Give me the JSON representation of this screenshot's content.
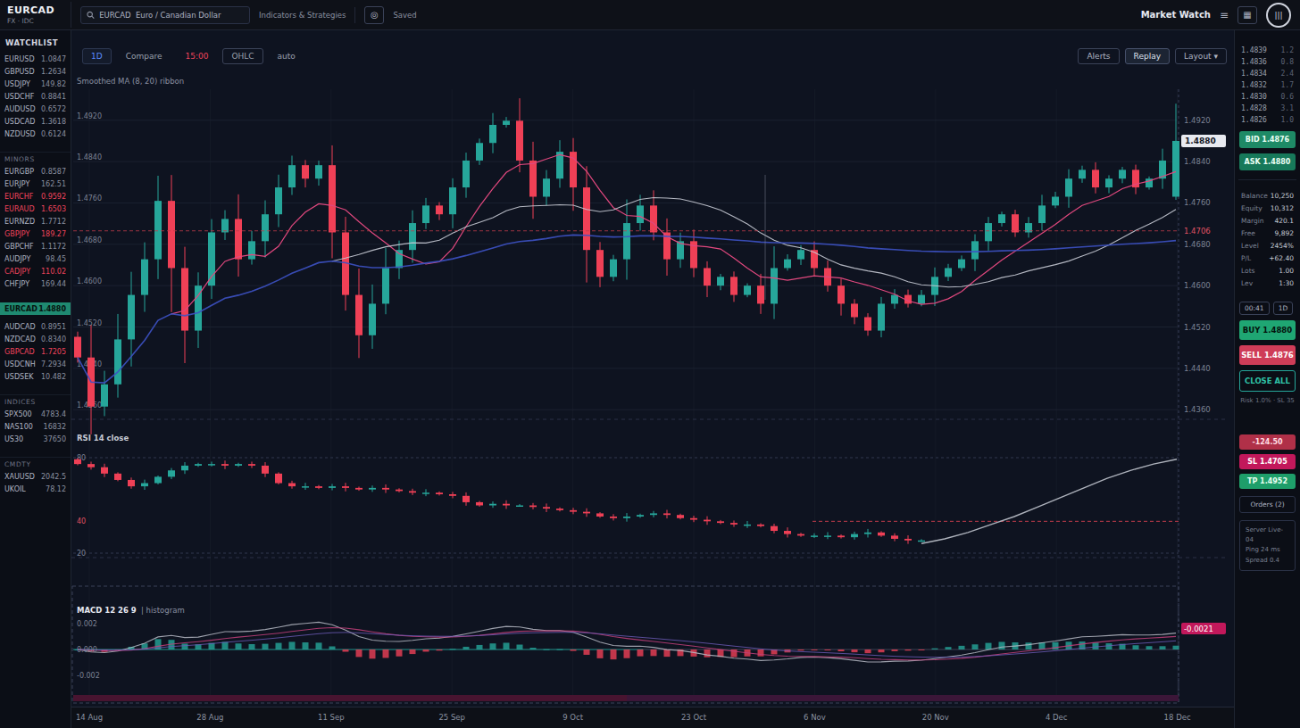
{
  "header": {
    "symbol": "EURCAD",
    "symbol_sub": "FX · IDC",
    "search_value": "EURCAD  Euro / Canadian Dollar",
    "indicators_label": "Indicators & Strategies",
    "saved_label": "Saved",
    "watch_title": "Market Watch"
  },
  "tabs": {
    "left": [
      {
        "label": "1D",
        "style": "active"
      },
      {
        "label": "Compare",
        "style": ""
      },
      {
        "label": "15:00",
        "style": "alert"
      },
      {
        "label": "OHLC",
        "style": "boxed"
      },
      {
        "label": "auto",
        "style": ""
      }
    ],
    "right": [
      {
        "label": "Alerts",
        "style": ""
      },
      {
        "label": "Replay",
        "style": "filled"
      },
      {
        "label": "Layout ▾",
        "style": ""
      }
    ]
  },
  "titles": {
    "main": "Smoothed MA (8, 20) ribbon",
    "panel2": "RSI 14 close",
    "panel3_bold": "MACD 12 26 9",
    "panel3_light": "| histogram"
  },
  "watchlist": {
    "title": "WATCHLIST",
    "rows": [
      {
        "sym": "EURUSD",
        "price": "1.0847"
      },
      {
        "sym": "GBPUSD",
        "price": "1.2634"
      },
      {
        "sym": "USDJPY",
        "price": "149.82"
      },
      {
        "sym": "USDCHF",
        "price": "0.8841"
      },
      {
        "sym": "AUDUSD",
        "price": "0.6572"
      },
      {
        "sym": "USDCAD",
        "price": "1.3618"
      },
      {
        "sym": "NZDUSD",
        "price": "0.6124"
      },
      {
        "sec": "MINORS"
      },
      {
        "sym": "EURGBP",
        "price": "0.8587"
      },
      {
        "sym": "EURJPY",
        "price": "162.51"
      },
      {
        "sym": "EURCHF",
        "price": "0.9592",
        "dir": "down"
      },
      {
        "sym": "EURAUD",
        "price": "1.6503",
        "dir": "down"
      },
      {
        "sym": "EURNZD",
        "price": "1.7712"
      },
      {
        "sym": "GBPJPY",
        "price": "189.27",
        "dir": "down"
      },
      {
        "sym": "GBPCHF",
        "price": "1.1172"
      },
      {
        "sym": "AUDJPY",
        "price": "98.45"
      },
      {
        "sym": "CADJPY",
        "price": "110.02",
        "dir": "down"
      },
      {
        "sym": "CHFJPY",
        "price": "169.44"
      },
      {
        "sym": "EURCAD",
        "price": "1.4880",
        "active": true
      },
      {
        "sym": "AUDCAD",
        "price": "0.8951"
      },
      {
        "sym": "NZDCAD",
        "price": "0.8340"
      },
      {
        "sym": "GBPCAD",
        "price": "1.7205",
        "dir": "down"
      },
      {
        "sym": "USDCNH",
        "price": "7.2934"
      },
      {
        "sym": "USDSEK",
        "price": "10.482"
      },
      {
        "sec": "INDICES"
      },
      {
        "sym": "SPX500",
        "price": "4783.4"
      },
      {
        "sym": "NAS100",
        "price": "16832"
      },
      {
        "sym": "US30",
        "price": "37650"
      },
      {
        "sec": "CMDTY"
      },
      {
        "sym": "XAUUSD",
        "price": "2042.5"
      },
      {
        "sym": "UKOIL",
        "price": "78.12"
      }
    ]
  },
  "right_panel": {
    "ladder": [
      [
        "1.4839",
        "1.2"
      ],
      [
        "1.4836",
        "0.8"
      ],
      [
        "1.4834",
        "2.4"
      ],
      [
        "1.4832",
        "1.7"
      ],
      [
        "1.4830",
        "0.6"
      ],
      [
        "1.4828",
        "3.1"
      ],
      [
        "1.4826",
        "1.0"
      ]
    ],
    "bid_label": "BID 1.4876",
    "ask_label": "ASK 1.4880",
    "account": [
      [
        "Balance",
        "10,250"
      ],
      [
        "Equity",
        "10,312"
      ],
      [
        "Margin",
        "420.1"
      ],
      [
        "Free",
        "9,892"
      ],
      [
        "Level",
        "2454%"
      ],
      [
        "P/L",
        "+62.40"
      ],
      [
        "Lots",
        "1.00"
      ],
      [
        "Lev",
        "1:30"
      ]
    ],
    "time_chip": "00:41",
    "tf_chip": "1D",
    "buy_button": "BUY 1.4880",
    "sell_button": "SELL 1.4876",
    "close_button": "CLOSE ALL",
    "risk_note": "Risk 1.0% · SL 35",
    "pl_badge": "-124.50",
    "sl_badge": "SL 1.4705",
    "tp_badge": "TP 1.4952",
    "orders_label": "Orders (2)",
    "status_lines": [
      "Server Live-04",
      "Ping 24 ms",
      "Spread 0.4"
    ]
  },
  "scale": {
    "last_tag": "1.4880",
    "dashed_tag": "1.4706",
    "macd_tag": "-0.0021"
  },
  "colors": {
    "up": "#26a69a",
    "down": "#ef4056",
    "ma_fast": "#e0487e",
    "ma_mid": "#c6cad4",
    "ma_slow": "#3d52c4",
    "dashed_level": "#c23b4b",
    "accent": "#2962ff"
  },
  "chart_data": [
    {
      "type": "candlestick",
      "panel": "price",
      "symbol": "EURCAD",
      "timeframe": "1D",
      "ylim": [
        1.435,
        1.498
      ],
      "y_ticks": [
        1.492,
        1.484,
        1.476,
        1.468,
        1.46,
        1.452,
        1.444,
        1.436
      ],
      "x_labels": [
        "14 Aug",
        "28 Aug",
        "11 Sep",
        "25 Sep",
        "9 Oct",
        "23 Oct",
        "6 Nov",
        "20 Nov",
        "4 Dec",
        "18 Dec"
      ],
      "closes": [
        1.4461,
        1.4366,
        1.4409,
        1.4496,
        1.4582,
        1.4651,
        1.4764,
        1.4634,
        1.4513,
        1.46,
        1.4703,
        1.4729,
        1.4651,
        1.4686,
        1.4738,
        1.479,
        1.4833,
        1.4807,
        1.4833,
        1.4703,
        1.4582,
        1.4504,
        1.4565,
        1.4634,
        1.4669,
        1.4721,
        1.4755,
        1.4738,
        1.479,
        1.4842,
        1.4876,
        1.4911,
        1.4919,
        1.4842,
        1.4772,
        1.4807,
        1.4859,
        1.479,
        1.4669,
        1.4617,
        1.4651,
        1.4721,
        1.4755,
        1.4703,
        1.4651,
        1.4686,
        1.4634,
        1.46,
        1.4617,
        1.4582,
        1.46,
        1.4565,
        1.4634,
        1.4651,
        1.4669,
        1.4634,
        1.46,
        1.4565,
        1.4539,
        1.4513,
        1.4565,
        1.4582,
        1.4565,
        1.4582,
        1.4617,
        1.4634,
        1.4651,
        1.4686,
        1.4721,
        1.4738,
        1.4703,
        1.4721,
        1.4755,
        1.4772,
        1.4807,
        1.4824,
        1.479,
        1.4807,
        1.4824,
        1.479,
        1.4807,
        1.4842,
        1.488
      ],
      "last_candle": {
        "open": 1.4772,
        "high": 1.4952,
        "low": 1.4766,
        "close": 1.488
      },
      "overlays": [
        {
          "name": "SMA fast",
          "window": 8,
          "color": "#e0487e"
        },
        {
          "name": "SMA mid",
          "window": 20,
          "color": "#c6cad4"
        },
        {
          "name": "Expanding mean",
          "color": "#3d52c4"
        },
        {
          "name": "Level",
          "type": "hline",
          "value": 1.4706,
          "style": "dashed",
          "color": "#c23b4b"
        }
      ]
    },
    {
      "type": "candlestick",
      "panel": "oscillator",
      "name": "RSI 14",
      "ylim": [
        20,
        80
      ],
      "y_ticks": [
        80,
        40,
        20
      ],
      "level_line": 40,
      "closes": [
        76,
        74,
        70,
        66,
        62,
        64,
        68,
        72,
        75,
        76,
        76,
        75,
        76,
        75,
        70,
        64,
        62,
        62,
        61,
        62,
        61,
        60,
        61,
        60,
        59,
        58,
        58,
        57,
        56,
        52,
        50,
        51,
        50,
        50,
        49,
        48,
        47,
        46,
        45,
        43,
        42,
        43,
        44,
        45,
        44,
        42,
        41,
        40,
        39,
        38,
        38,
        37,
        34,
        32,
        31,
        31,
        31,
        30,
        32,
        33,
        31,
        29,
        28,
        28
      ],
      "recovery_line": [
        26,
        29,
        33,
        38,
        43,
        49,
        55,
        61,
        67,
        72,
        76,
        79
      ]
    },
    {
      "type": "macd",
      "panel": "macd",
      "name": "MACD 12 26 9",
      "params": {
        "fast": 12,
        "slow": 26,
        "signal": 9
      },
      "y_ticks": [
        "0.002",
        "0.000",
        "-0.002"
      ]
    }
  ]
}
